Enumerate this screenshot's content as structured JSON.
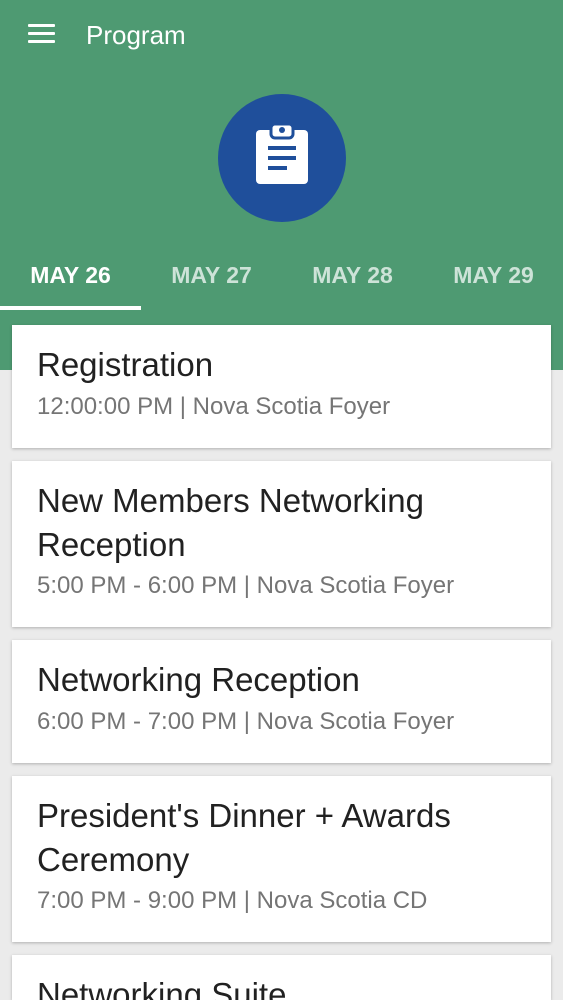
{
  "toolbar": {
    "title": "Program",
    "menu_icon": "hamburger-menu-icon"
  },
  "hero": {
    "icon": "clipboard-icon",
    "icon_bg_color": "#1f4f9b"
  },
  "colors": {
    "header_bg": "#4e9a72",
    "page_bg": "#ebebeb"
  },
  "tabs": [
    {
      "label": "MAY 26",
      "selected": true
    },
    {
      "label": "MAY 27",
      "selected": false
    },
    {
      "label": "MAY 28",
      "selected": false
    },
    {
      "label": "MAY 29",
      "selected": false
    }
  ],
  "events": [
    {
      "title": "Registration",
      "details": "12:00:00 PM | Nova Scotia Foyer"
    },
    {
      "title": "New Members Networking Reception",
      "details": "5:00 PM - 6:00 PM | Nova Scotia Foyer"
    },
    {
      "title": "Networking Reception",
      "details": "6:00 PM - 7:00 PM | Nova Scotia Foyer"
    },
    {
      "title": "President's Dinner + Awards Ceremony",
      "details": "7:00 PM - 9:00 PM | Nova Scotia CD"
    },
    {
      "title": "Networking Suite",
      "details": ""
    }
  ]
}
